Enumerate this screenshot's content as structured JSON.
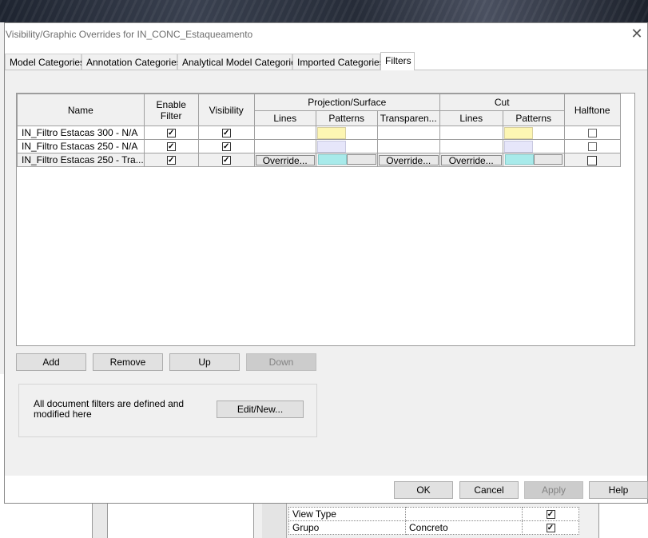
{
  "dialog": {
    "title": "Visibility/Graphic Overrides for IN_CONC_Estaqueamento"
  },
  "tabs": [
    {
      "label": "Model Categories",
      "active": false
    },
    {
      "label": "Annotation Categories",
      "active": false
    },
    {
      "label": "Analytical Model Categories",
      "active": false
    },
    {
      "label": "Imported Categories",
      "active": false
    },
    {
      "label": "Filters",
      "active": true
    }
  ],
  "grid": {
    "headers": {
      "name": "Name",
      "enable_filter": "Enable Filter",
      "visibility": "Visibility",
      "projection_surface": "Projection/Surface",
      "cut": "Cut",
      "halftone": "Halftone",
      "lines": "Lines",
      "patterns": "Patterns",
      "transparency": "Transparen...",
      "cut_lines": "Lines",
      "cut_patterns": "Patterns"
    },
    "rows": [
      {
        "name": "IN_Filtro Estacas 300 - N/A",
        "enable_filter": true,
        "visibility": true,
        "halftone": false,
        "surface_pattern_color": "#fdf6b3",
        "cut_pattern_color": "#fdf6b3"
      },
      {
        "name": "IN_Filtro Estacas 250 - N/A",
        "enable_filter": true,
        "visibility": true,
        "halftone": false,
        "surface_pattern_color": "#e6e6fa",
        "cut_pattern_color": "#e6e6fa"
      },
      {
        "name": "IN_Filtro Estacas 250 - Tra...",
        "enable_filter": true,
        "visibility": true,
        "halftone": false,
        "surface_pattern_color": "#a8eaea",
        "cut_pattern_color": "#a8eaea",
        "override_label": "Override...",
        "selected": true
      }
    ]
  },
  "buttons": {
    "add": "Add",
    "remove": "Remove",
    "up": "Up",
    "down": "Down",
    "edit_new": "Edit/New...",
    "ok": "OK",
    "cancel": "Cancel",
    "apply": "Apply",
    "help": "Help"
  },
  "info": {
    "text": "All document filters are defined and modified here"
  },
  "background_properties": [
    {
      "label": "View Type",
      "value": "",
      "checked": true
    },
    {
      "label": "Grupo",
      "value": "Concreto",
      "checked": true
    }
  ]
}
